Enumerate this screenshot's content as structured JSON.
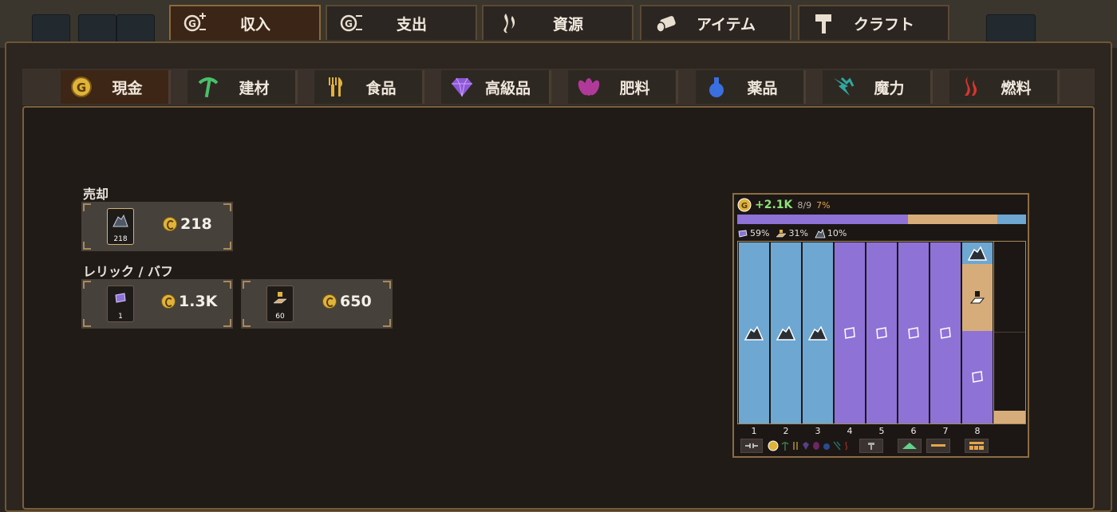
{
  "top_tabs": [
    {
      "label": "収入",
      "icon": "coin-plus-icon",
      "active": true
    },
    {
      "label": "支出",
      "icon": "coin-minus-icon",
      "active": false
    },
    {
      "label": "資源",
      "icon": "flame-icon",
      "active": false
    },
    {
      "label": "アイテム",
      "icon": "log-icon",
      "active": false
    },
    {
      "label": "クラフト",
      "icon": "hammer-icon",
      "active": false
    }
  ],
  "sub_tabs": [
    {
      "label": "現金",
      "icon": "coin-icon",
      "active": true
    },
    {
      "label": "建材",
      "icon": "pickaxe-icon",
      "active": false
    },
    {
      "label": "食品",
      "icon": "fork-knife-icon",
      "active": false
    },
    {
      "label": "高級品",
      "icon": "gem-icon",
      "active": false
    },
    {
      "label": "肥料",
      "icon": "lotus-icon",
      "active": false
    },
    {
      "label": "薬品",
      "icon": "potion-icon",
      "active": false
    },
    {
      "label": "魔力",
      "icon": "mana-crystal-icon",
      "active": false
    },
    {
      "label": "燃料",
      "icon": "fire-icon",
      "active": false
    }
  ],
  "sections": {
    "sale": {
      "title": "売却",
      "items": [
        {
          "icon": "coal-ore-icon",
          "count": "218",
          "value": "218"
        }
      ]
    },
    "relic": {
      "title": "レリック / バフ",
      "items": [
        {
          "icon": "scroll-icon",
          "count": "1",
          "value": "1.3K"
        },
        {
          "icon": "stamp-icon",
          "count": "60",
          "value": "650"
        }
      ]
    }
  },
  "mini_panel": {
    "rate": "+2.1K",
    "fraction": "8/9",
    "percent": "7%",
    "legend": [
      {
        "icon": "scroll-icon",
        "label": "59%",
        "color": "#8e72d6"
      },
      {
        "icon": "stamp-icon",
        "label": "31%",
        "color": "#d6ad7a"
      },
      {
        "icon": "coal-ore-icon",
        "label": "10%",
        "color": "#6ea7d1"
      }
    ],
    "column_numbers": [
      "1",
      "2",
      "3",
      "4",
      "5",
      "6",
      "7",
      "8"
    ]
  },
  "chart_data": {
    "type": "bar",
    "categories": [
      "1",
      "2",
      "3",
      "4",
      "5",
      "6",
      "7",
      "8"
    ],
    "stacked_segments": [
      [
        {
          "item": "coal",
          "share": 1.0
        }
      ],
      [
        {
          "item": "coal",
          "share": 1.0
        }
      ],
      [
        {
          "item": "coal",
          "share": 1.0
        }
      ],
      [
        {
          "item": "scroll",
          "share": 1.0
        }
      ],
      [
        {
          "item": "scroll",
          "share": 1.0
        }
      ],
      [
        {
          "item": "scroll",
          "share": 1.0
        }
      ],
      [
        {
          "item": "scroll",
          "share": 1.0
        }
      ],
      [
        {
          "item": "coal",
          "share": 0.12
        },
        {
          "item": "stamp",
          "share": 0.37
        },
        {
          "item": "scroll",
          "share": 0.51
        }
      ]
    ],
    "totals": {
      "scroll": "59%",
      "stamp": "31%",
      "coal": "10%"
    },
    "colors": {
      "coal": "#6ea7d1",
      "scroll": "#8e72d6",
      "stamp": "#d6ad7a"
    }
  }
}
